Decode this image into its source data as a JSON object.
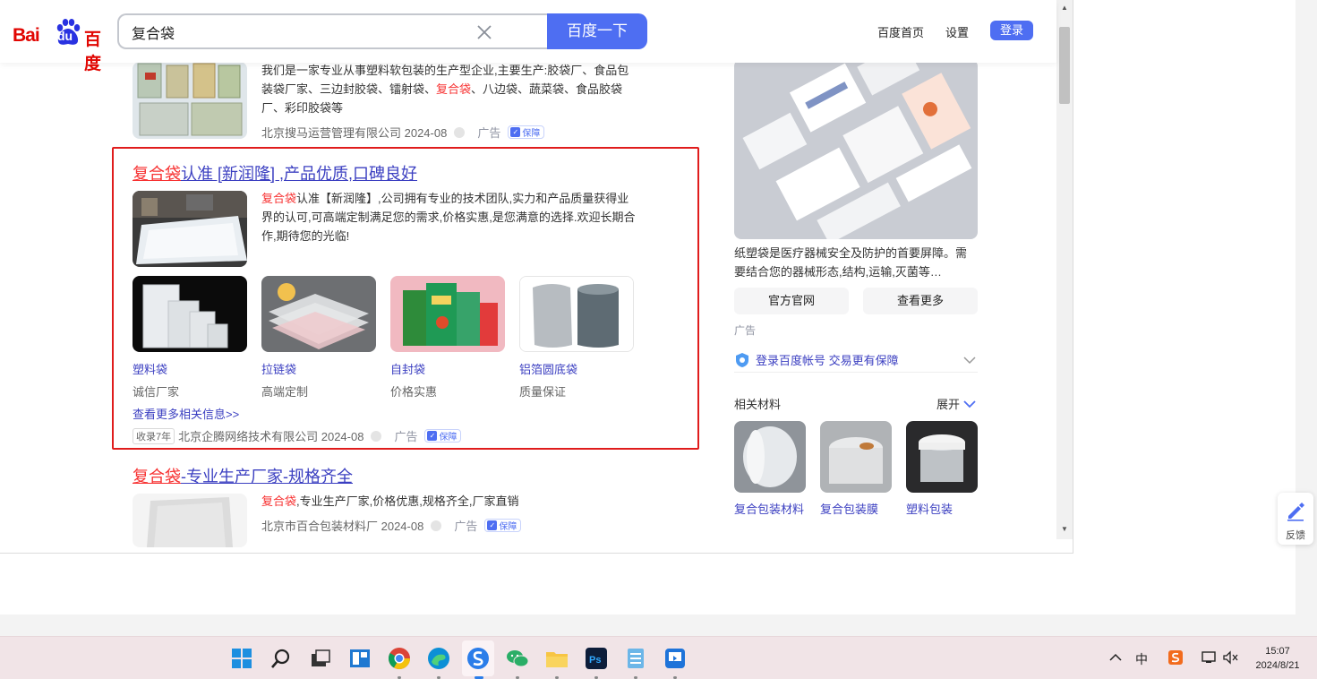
{
  "header": {
    "logo_bai": "Bai",
    "logo_du": "du",
    "logo_cn": "百度",
    "search_value": "复合袋",
    "search_button": "百度一下",
    "links": [
      "百度首页",
      "设置"
    ],
    "login": "登录"
  },
  "result1": {
    "desc_pre": "我们是一家专业从事塑料软包装的生产型企业,主要生产:胶袋厂、食品包装袋厂家、三边封胶袋、镭射袋、",
    "desc_red": "复合袋",
    "desc_post": "、八边袋、蔬菜袋、食品胶袋厂、彩印胶袋等",
    "company": "北京搜马运营管理有限公司 2024-08",
    "ad": "广告",
    "guard": "保障"
  },
  "result2": {
    "title_red": "复合袋",
    "title_rest": "认准 [新润隆] ,产品优质,口碑良好",
    "desc_red": "复合袋",
    "desc_rest": "认准【新润隆】,公司拥有专业的技术团队,实力和产品质量获得业界的认可,可高端定制满足您的需求,价格实惠,是您满意的选择.欢迎长期合作,期待您的光临!",
    "products": [
      {
        "name": "塑料袋",
        "sub": "诚信厂家"
      },
      {
        "name": "拉链袋",
        "sub": "高端定制"
      },
      {
        "name": "自封袋",
        "sub": "价格实惠"
      },
      {
        "name": "铝箔圆底袋",
        "sub": "质量保证"
      }
    ],
    "more": "查看更多相关信息>>",
    "record": "收录7年",
    "company": "北京企腾网络技术有限公司 2024-08",
    "ad": "广告",
    "guard": "保障"
  },
  "result3": {
    "title_red": "复合袋",
    "title_rest": "-专业生产厂家-规格齐全",
    "desc_red": "复合袋",
    "desc_rest": ",专业生产厂家,价格优惠,规格齐全,厂家直销",
    "company": "北京市百合包装材料厂 2024-08",
    "ad": "广告",
    "guard": "保障"
  },
  "right_ad": {
    "desc": "纸塑袋是医疗器械安全及防护的首要屏障。需要结合您的器械形态,结构,运输,灭菌等…",
    "btn_official": "官方官网",
    "btn_more": "查看更多",
    "ad": "广告",
    "login_tip": "登录百度帐号 交易更有保障"
  },
  "related": {
    "title": "相关材料",
    "expand": "展开",
    "items": [
      "复合包装材料",
      "复合包装膜",
      "塑料包装"
    ]
  },
  "feedback": "反馈",
  "taskbar": {
    "time": "15:07",
    "date": "2024/8/21",
    "ime": "中"
  }
}
